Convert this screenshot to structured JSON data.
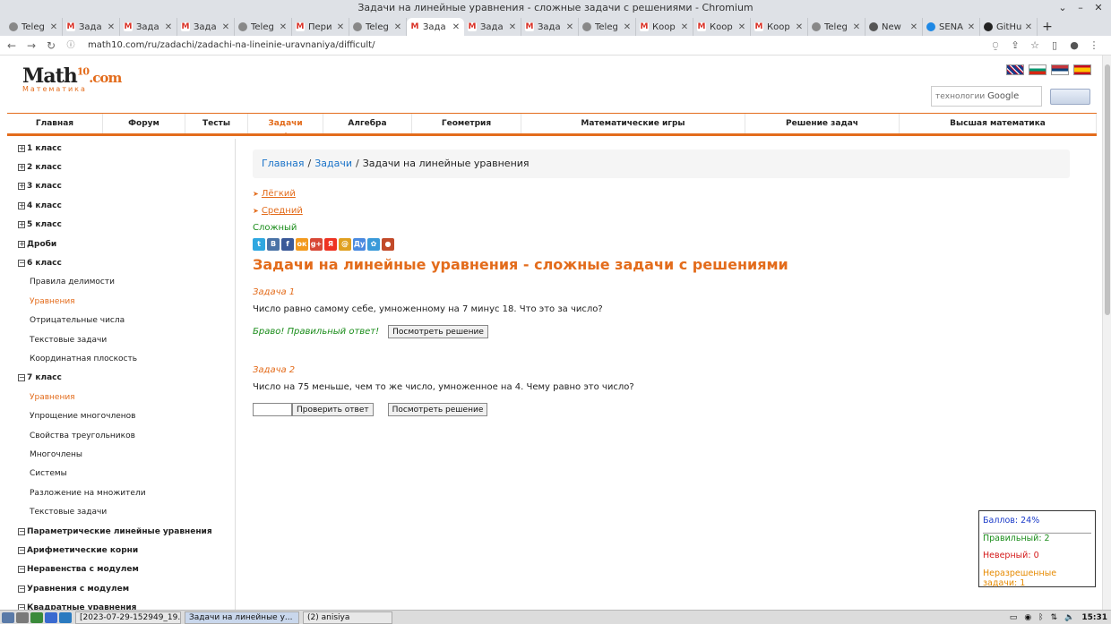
{
  "window": {
    "title": "Задачи на линейные уравнения - сложные задачи с решениями - Chromium"
  },
  "tabs": [
    {
      "label": "Teleg",
      "icon": "telegram-icon",
      "kind": "tg"
    },
    {
      "label": "Зада",
      "icon": "gmail-icon",
      "kind": "gm"
    },
    {
      "label": "Зада",
      "icon": "gmail-icon",
      "kind": "gm"
    },
    {
      "label": "Зада",
      "icon": "gmail-icon",
      "kind": "gm"
    },
    {
      "label": "Teleg",
      "icon": "telegram-icon",
      "kind": "tg"
    },
    {
      "label": "Пери",
      "icon": "gmail-icon",
      "kind": "gm"
    },
    {
      "label": "Teleg",
      "icon": "telegram-icon",
      "kind": "tg"
    },
    {
      "label": "Зада",
      "icon": "gmail-icon",
      "kind": "gm",
      "active": true
    },
    {
      "label": "Зада",
      "icon": "gmail-icon",
      "kind": "gm"
    },
    {
      "label": "Зада",
      "icon": "gmail-icon",
      "kind": "gm"
    },
    {
      "label": "Teleg",
      "icon": "telegram-icon",
      "kind": "tg"
    },
    {
      "label": "Коор",
      "icon": "gmail-icon",
      "kind": "gm"
    },
    {
      "label": "Коор",
      "icon": "gmail-icon",
      "kind": "gm"
    },
    {
      "label": "Коор",
      "icon": "gmail-icon",
      "kind": "gm"
    },
    {
      "label": "Teleg",
      "icon": "telegram-icon",
      "kind": "tg"
    },
    {
      "label": "New",
      "icon": "chromium-icon",
      "kind": "nw"
    },
    {
      "label": "SENA",
      "icon": "sena-icon",
      "kind": "sn"
    },
    {
      "label": "GitHu",
      "icon": "github-icon",
      "kind": "gh"
    }
  ],
  "address": {
    "url": "math10.com/ru/zadachi/zadachi-na-lineinie-uravnaniya/difficult/"
  },
  "site": {
    "logo_main": "Math",
    "logo_ten": "10",
    "logo_com": ".com",
    "logo_sub": "Математика",
    "search_placeholder": "технологии",
    "search_brand": "Google"
  },
  "menu": [
    {
      "label": "Главная",
      "w": 107
    },
    {
      "label": "Форум",
      "w": 92
    },
    {
      "label": "Тесты",
      "w": 70
    },
    {
      "label": "Задачи",
      "w": 84,
      "active": true
    },
    {
      "label": "Алгебра",
      "w": 99
    },
    {
      "label": "Геометрия",
      "w": 122
    },
    {
      "label": "Математические игры",
      "w": 250
    },
    {
      "label": "Решение задач",
      "w": 172
    },
    {
      "label": "Высшая математика",
      "w": 220
    }
  ],
  "sidebar": [
    {
      "label": "1 класс",
      "type": "top",
      "sign": "+"
    },
    {
      "label": "2 класс",
      "type": "top",
      "sign": "+"
    },
    {
      "label": "3 класс",
      "type": "top",
      "sign": "+"
    },
    {
      "label": "4 класс",
      "type": "top",
      "sign": "+"
    },
    {
      "label": "5 класс",
      "type": "top",
      "sign": "+"
    },
    {
      "label": "Дроби",
      "type": "top",
      "sign": "+"
    },
    {
      "label": "6 класс",
      "type": "top",
      "sign": "−"
    },
    {
      "label": "Правила делимости",
      "type": "sub"
    },
    {
      "label": "Уравнения",
      "type": "sub",
      "active": true
    },
    {
      "label": "Отрицательные числа",
      "type": "sub"
    },
    {
      "label": "Текстовые задачи",
      "type": "sub"
    },
    {
      "label": "Координатная плоскость",
      "type": "sub"
    },
    {
      "label": "7 класс",
      "type": "top",
      "sign": "−"
    },
    {
      "label": "Уравнения",
      "type": "sub",
      "active": true
    },
    {
      "label": "Упрощение многочленов",
      "type": "sub"
    },
    {
      "label": "Свойства треугольников",
      "type": "sub"
    },
    {
      "label": "Многочлены",
      "type": "sub"
    },
    {
      "label": "Системы",
      "type": "sub"
    },
    {
      "label": "Разложение на множители",
      "type": "sub"
    },
    {
      "label": "Текстовые задачи",
      "type": "sub"
    },
    {
      "label": "Параметрические линейные уравнения",
      "type": "top",
      "sign": "−"
    },
    {
      "label": "Арифметические корни",
      "type": "top",
      "sign": "−"
    },
    {
      "label": "Неравенства с модулем",
      "type": "top",
      "sign": "−"
    },
    {
      "label": "Уравнения с модулем",
      "type": "top",
      "sign": "−"
    },
    {
      "label": "Квадратные уравнения",
      "type": "top",
      "sign": "−"
    }
  ],
  "breadcrumb": {
    "home": "Главная",
    "tasks": "Задачи",
    "current": "Задачи на линейные уравнения",
    "sep": "/"
  },
  "levels": {
    "easy": "Лёгкий",
    "medium": "Средний",
    "hard": "Сложный"
  },
  "share_icons": [
    {
      "name": "twitter-icon",
      "glyph": "t",
      "color": "#2fa7e0"
    },
    {
      "name": "vk-icon",
      "glyph": "В",
      "color": "#4a73a6"
    },
    {
      "name": "facebook-icon",
      "glyph": "f",
      "color": "#3b5998"
    },
    {
      "name": "odnoklassniki-icon",
      "glyph": "ок",
      "color": "#f39a1e"
    },
    {
      "name": "googleplus-icon",
      "glyph": "g+",
      "color": "#d84836"
    },
    {
      "name": "yandex-icon",
      "glyph": "Я",
      "color": "#ee3322"
    },
    {
      "name": "mailru-icon",
      "glyph": "@",
      "color": "#e0a020"
    },
    {
      "name": "liveinternet-icon",
      "glyph": "Ду",
      "color": "#4a8ae0"
    },
    {
      "name": "settings-icon",
      "glyph": "✿",
      "color": "#3a9ad9"
    },
    {
      "name": "moikrug-icon",
      "glyph": "●",
      "color": "#c24a2a"
    }
  ],
  "page_title": "Задачи на линейные уравнения - сложные задачи с решениями",
  "task1": {
    "head": "Задача 1",
    "text": "Число равно самому себе, умноженному на 7 минус 18. Что это за число?",
    "result": "Браво! Правильный ответ!",
    "solution_btn": "Посмотреть решение"
  },
  "task2": {
    "head": "Задача 2",
    "text": "Число на 75 меньше, чем то же число, умноженное на 4. Чему равно это число?",
    "check_btn": "Проверить ответ",
    "solution_btn": "Посмотреть решение"
  },
  "score": {
    "points": "Баллов: 24%",
    "correct": "Правильный: 2",
    "wrong": "Неверный: 0",
    "unsolved": "Неразрешенные задачи: 1"
  },
  "taskbar": {
    "task1": "[2023-07-29-152949_19...",
    "task2": "Задачи на линейные у...",
    "task3": "(2) anisiya",
    "clock": "15:31"
  }
}
